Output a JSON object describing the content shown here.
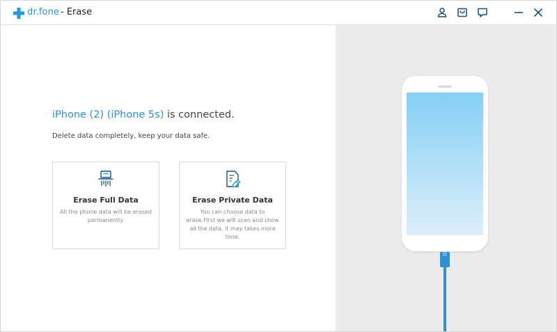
{
  "app": {
    "brand": "dr.fone",
    "module_title": "- Erase"
  },
  "titlebar": {
    "icons": [
      "account-icon",
      "cart-icon",
      "feedback-icon",
      "minimize-icon",
      "close-icon"
    ]
  },
  "main": {
    "device_name": "iPhone (2) (iPhone 5s)",
    "connected_text": " is connected.",
    "subtitle": "Delete data completely, keep your data safe.",
    "options": [
      {
        "title": "Erase Full Data",
        "description": "All the phone data will be erased permanently.",
        "icon": "shredder-icon"
      },
      {
        "title": "Erase Private Data",
        "description": "You can choose data to erase.First we will scan and show all the data, it may takes more time.",
        "icon": "document-erase-icon"
      }
    ]
  },
  "colors": {
    "accent": "#1e9ae0",
    "device_text": "#2b90d9",
    "right_panel": "#ebebeb",
    "cable": "#2a90d8"
  }
}
